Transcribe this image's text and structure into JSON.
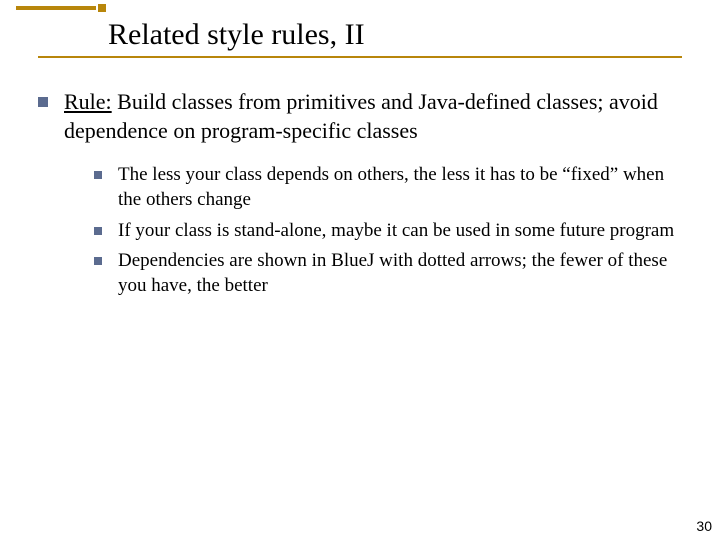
{
  "title": "Related style rules, II",
  "main": {
    "rule_label": "Rule:",
    "rule_text": " Build classes from primitives and Java-defined classes; avoid dependence on program-specific classes"
  },
  "subs": [
    "The less your class depends on others, the less it has to be “fixed” when the others change",
    "If your class is stand-alone, maybe it can be used in some future program",
    "Dependencies are shown in BlueJ with dotted arrows; the fewer of these you have, the better"
  ],
  "page_number": "30"
}
